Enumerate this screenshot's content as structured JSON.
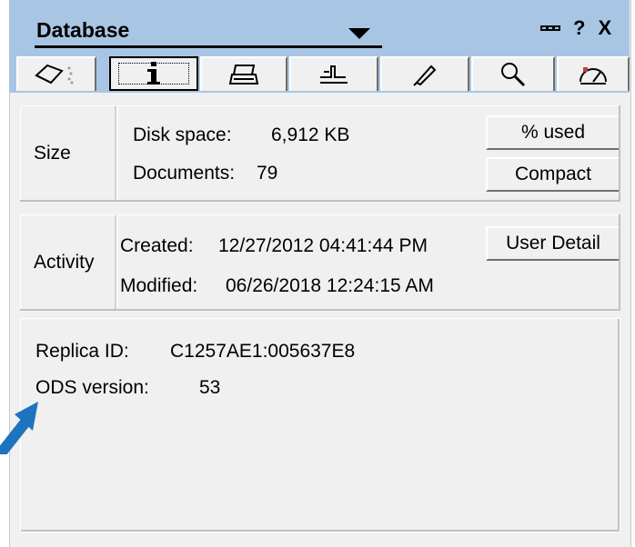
{
  "panel": {
    "title": "Database",
    "controls": {
      "pin": "pin-icon",
      "help": "?",
      "close": "X"
    }
  },
  "tabs": [
    {
      "icon": "eraser-icon"
    },
    {
      "icon": "info-icon",
      "label": "i",
      "active": true
    },
    {
      "icon": "printer-icon"
    },
    {
      "icon": "design-icon"
    },
    {
      "icon": "pen-icon"
    },
    {
      "icon": "magnifier-icon"
    },
    {
      "icon": "dashboard-icon"
    }
  ],
  "size": {
    "title": "Size",
    "disk_label": "Disk space:",
    "disk_value": "6,912 KB",
    "docs_label": "Documents:",
    "docs_value": "79",
    "percent_used_button": "% used",
    "compact_button": "Compact"
  },
  "activity": {
    "title": "Activity",
    "created_label": "Created:",
    "created_value": "12/27/2012 04:41:44 PM",
    "modified_label": "Modified:",
    "modified_value": "06/26/2018 12:24:15 AM",
    "user_detail_button": "User Detail"
  },
  "info": {
    "replica_label": "Replica ID:",
    "replica_value": "C1257AE1:005637E8",
    "ods_label": "ODS version:",
    "ods_value": "53"
  },
  "colors": {
    "titlebar": "#a9c5e4",
    "panel": "#f0f0f0",
    "arrow": "#1e73be"
  }
}
